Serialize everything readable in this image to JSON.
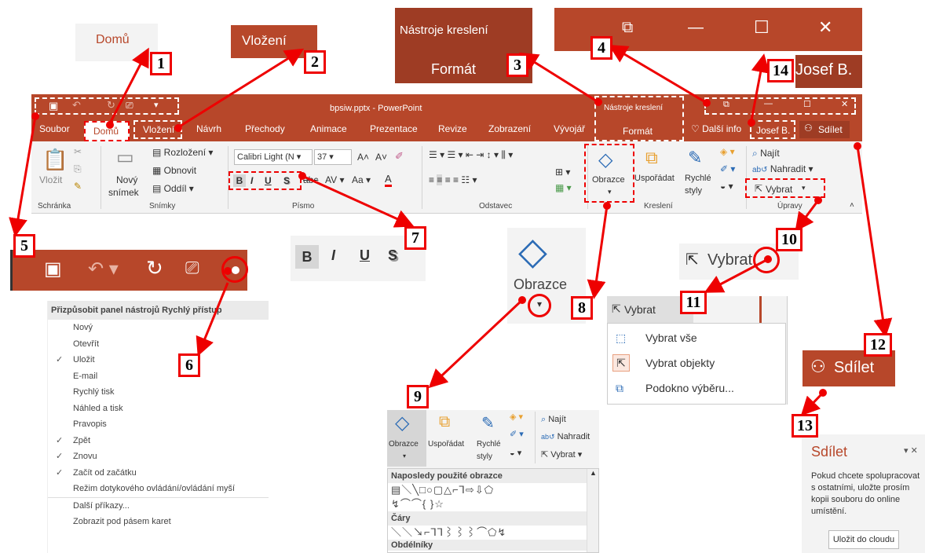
{
  "zoom_domu": {
    "label": "Domů"
  },
  "zoom_vlozeni": {
    "label": "Vložení"
  },
  "zoom_nastroje": {
    "group": "Nástroje kreslení",
    "tab": "Formát"
  },
  "zoom_window": {
    "restore": "⧉",
    "minimize": "—",
    "maximize": "☐",
    "close": "✕"
  },
  "zoom_user": {
    "label": "Josef B."
  },
  "titlebar": {
    "title": "bpsiw.pptx - PowerPoint",
    "tools_group": "Nástroje kreslení",
    "tools_tab": "Formát"
  },
  "tabs": {
    "soubor": "Soubor",
    "domu": "Domů",
    "vlozeni": "Vložení",
    "navrh": "Návrh",
    "prechody": "Přechody",
    "animace": "Animace",
    "prezentace": "Prezentace",
    "revize": "Revize",
    "zobrazeni": "Zobrazení",
    "vyvojar": "Vývojář",
    "dalsi": "Další info",
    "user": "Josef B.",
    "share": "Sdílet"
  },
  "ribbon": {
    "vlozit": "Vložit",
    "novy": "Nový",
    "snimek": "snímek",
    "rozlozeni": "Rozložení",
    "obnovit": "Obnovit",
    "oddil": "Oddíl",
    "font_name": "Calibri Light (N",
    "font_size": "37",
    "obrazce": "Obrazce",
    "usporadat": "Uspořádat",
    "rychle": "Rychlé",
    "styly": "styly",
    "najit": "Najít",
    "nahradit": "Nahradit",
    "vybrat": "Vybrat",
    "groups": {
      "schranka": "Schránka",
      "snimky": "Snímky",
      "pismo": "Písmo",
      "odstavec": "Odstavec",
      "kresleni": "Kreslení",
      "upravy": "Úpravy"
    }
  },
  "format_buttons": {
    "bold": "B",
    "italic": "I",
    "underline": "U",
    "shadow": "S"
  },
  "zoom_obrazce": {
    "label": "Obrazce"
  },
  "zoom_vybrat": {
    "label": "Vybrat"
  },
  "vybrat_menu": {
    "button": "Vybrat",
    "items": [
      "Vybrat vše",
      "Vybrat objekty",
      "Podokno výběru..."
    ]
  },
  "zoom_share": {
    "label": "Sdílet"
  },
  "qat_menu": {
    "title": "Přizpůsobit panel nástrojů Rychlý přístup",
    "items": [
      {
        "label": "Nový",
        "checked": false
      },
      {
        "label": "Otevřít",
        "checked": false
      },
      {
        "label": "Uložit",
        "checked": true
      },
      {
        "label": "E-mail",
        "checked": false
      },
      {
        "label": "Rychlý tisk",
        "checked": false
      },
      {
        "label": "Náhled a tisk",
        "checked": false
      },
      {
        "label": "Pravopis",
        "checked": false
      },
      {
        "label": "Zpět",
        "checked": true
      },
      {
        "label": "Znovu",
        "checked": true
      },
      {
        "label": "Začít od začátku",
        "checked": true
      },
      {
        "label": "Režim dotykového ovládání/ovládání myší",
        "checked": false
      },
      {
        "label": "Další příkazy...",
        "checked": false
      },
      {
        "label": "Zobrazit pod pásem karet",
        "checked": false
      }
    ]
  },
  "shapes_panel": {
    "obrazce": "Obrazce",
    "usporadat": "Uspořádat",
    "rychle": "Rychlé",
    "styly": "styly",
    "najit": "Najít",
    "nahradit": "Nahradit",
    "vybrat": "Vybrat",
    "recent_header": "Naposledy použité obrazce",
    "recent_row1": "▤＼╲□○▢△⌐⅂⇨⇩⬠",
    "recent_row2": "↯⌒⌒{ }☆",
    "lines_header": "Čáry",
    "lines_row": "＼＼↘⌐⅂⅂⌇⌇⌇⌒⬠↯",
    "rect_header": "Obdélníky"
  },
  "share_pane": {
    "title": "Sdílet",
    "text": "Pokud chcete spolupracovat s ostatními, uložte prosím kopii souboru do online umístění.",
    "button": "Uložit do cloudu"
  },
  "callouts": [
    "1",
    "2",
    "3",
    "4",
    "5",
    "6",
    "7",
    "8",
    "9",
    "10",
    "11",
    "12",
    "13",
    "14"
  ],
  "colors": {
    "accent": "#b7472a",
    "annotation": "#e00000"
  }
}
